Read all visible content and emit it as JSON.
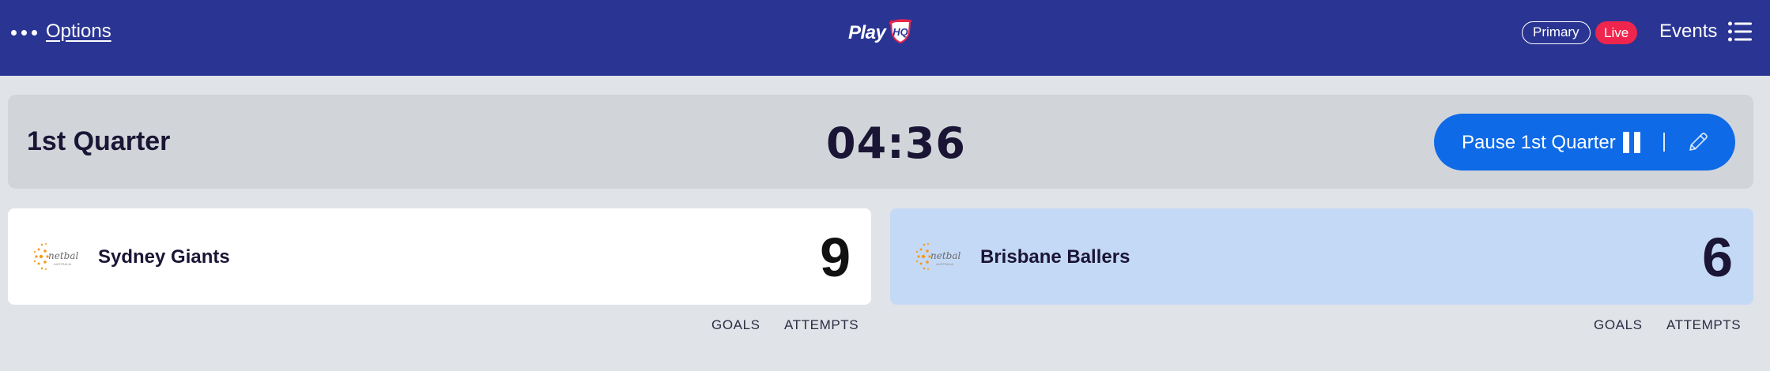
{
  "header": {
    "options_label": "Options",
    "logo_text": "Play",
    "logo_badge_text": "HQ",
    "primary_label": "Primary",
    "live_label": "Live",
    "events_label": "Events"
  },
  "quarter": {
    "title": "1st Quarter",
    "timer": "04:36",
    "pause_label": "Pause 1st Quarter"
  },
  "teams": [
    {
      "name": "Sydney Giants",
      "score": "9",
      "logo_text": "netball",
      "logo_subtext": "AUSTRALIA",
      "goals_label": "GOALS",
      "attempts_label": "ATTEMPTS"
    },
    {
      "name": "Brisbane Ballers",
      "score": "6",
      "logo_text": "netball",
      "logo_subtext": "AUSTRALIA",
      "goals_label": "GOALS",
      "attempts_label": "ATTEMPTS"
    }
  ],
  "colors": {
    "header_bg": "#2a3593",
    "live_badge": "#f0254d",
    "pause_button": "#0e6ae6",
    "home_card": "#ffffff",
    "away_card": "#c4d9f6"
  },
  "icons": [
    "more-dots-icon",
    "playhq-logo",
    "list-menu-icon",
    "pause-icon",
    "edit-pencil-icon",
    "netball-australia-logo"
  ]
}
